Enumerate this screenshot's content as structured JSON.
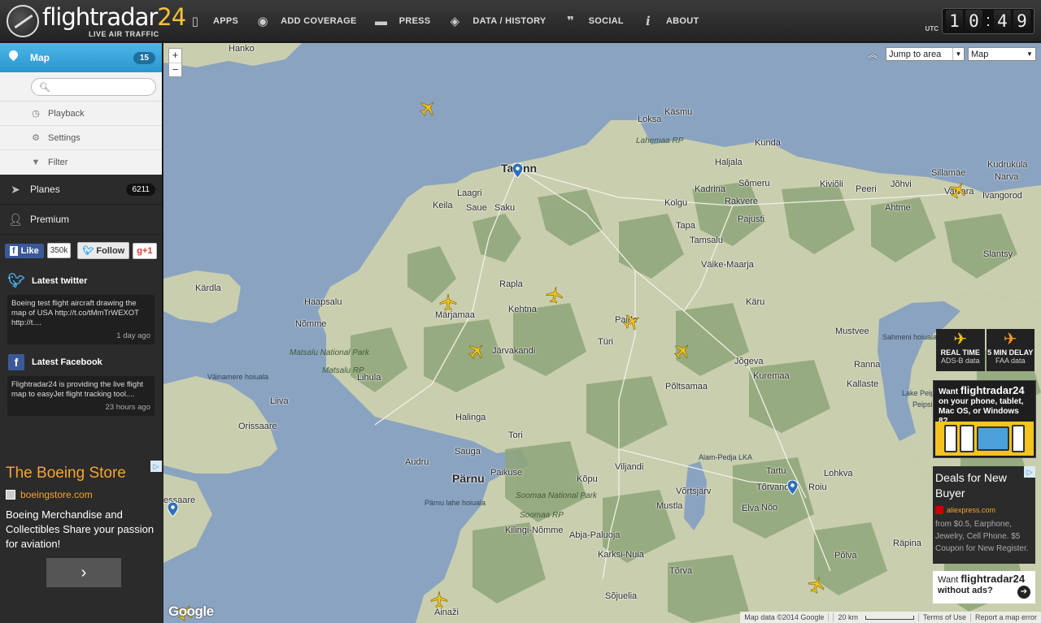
{
  "brand": {
    "name_main": "flightradar",
    "name_num": "24",
    "tagline": "LIVE AIR TRAFFIC"
  },
  "nav": [
    {
      "label": "APPS",
      "icon": "phone-icon"
    },
    {
      "label": "ADD COVERAGE",
      "icon": "eye-icon"
    },
    {
      "label": "PRESS",
      "icon": "speech-bubble-icon"
    },
    {
      "label": "DATA / HISTORY",
      "icon": "database-icon"
    },
    {
      "label": "SOCIAL",
      "icon": "quote-icon"
    },
    {
      "label": "ABOUT",
      "icon": "info-icon"
    }
  ],
  "clock": {
    "zone": "UTC",
    "h1": "1",
    "h2": "0",
    "sep": ":",
    "m1": "4",
    "m2": "9"
  },
  "sidebar": {
    "map_label": "Map",
    "map_count": "15",
    "search_placeholder": "",
    "playback": "Playback",
    "settings": "Settings",
    "filter": "Filter",
    "planes_label": "Planes",
    "planes_count": "6211",
    "premium": "Premium",
    "fb_like": "Like",
    "fb_count": "350k",
    "tw_follow": "Follow",
    "gplus": "g+1",
    "twitter_title": "Latest twitter",
    "twitter_text": "Boeing test flight aircraft drawing the map of USA http://t.co/tMmTrWEXOT http://t....",
    "twitter_time": "1 day ago",
    "facebook_title": "Latest Facebook",
    "facebook_text": "Flightradar24 is providing the live flight map to easyJet flight tracking tool....",
    "facebook_time": "23 hours ago"
  },
  "ad_left": {
    "title": "The Boeing Store",
    "url": "boeingstore.com",
    "body": "Boeing Merchandise and Collectibles Share your passion for aviation!",
    "button": "›"
  },
  "map": {
    "zoom_in": "+",
    "zoom_out": "−",
    "jump_to": "Jump to area",
    "map_type": "Map",
    "places": [
      "Hanko",
      "Käsmu",
      "Loksa",
      "Lahemaa RP",
      "Kunda",
      "Tallinn",
      "Haljala",
      "Sillamäe",
      "Kudruküla",
      "Narva",
      "Laagri",
      "Kadrina",
      "Sõmeru",
      "Kiviõli",
      "Peeri",
      "Jõhvi",
      "Keila",
      "Saue",
      "Saku",
      "Kolgu",
      "Rakvere",
      "Ahtme",
      "Vaivara",
      "Ivangorod",
      "Tapa",
      "Pajusti",
      "Tamsalu",
      "Slantsy",
      "Väike-Maarja",
      "Kärdla",
      "Haapsalu",
      "Rapla",
      "Kehtna",
      "Märjamaa",
      "Käru",
      "Nõmme",
      "Paide",
      "Türi",
      "Mustvee",
      "Sahmeni hoiualа",
      "Matsalu National Park",
      "Matsalu RP",
      "Järvakandi",
      "Jõgeva",
      "Ranna",
      "Väinamere hoiuala",
      "Lihula",
      "Kuremaa",
      "Põltsamaa",
      "Kallaste",
      "Lake Peipus",
      "Peipsi järv",
      "Liiva",
      "Orissaare",
      "Halinga",
      "Tori",
      "Audru",
      "Sauga",
      "Pärnu",
      "Paikuse",
      "Viljandi",
      "Alam-Pedja LKA",
      "Tartu",
      "Lohkva",
      "Pärnu lahe hoiuala",
      "Kõpu",
      "Võrtsjärv",
      "Tõrvandi",
      "Roiu",
      "Soomaa National Park",
      "Soomaa RP",
      "Mustla",
      "Elva",
      "Nõo",
      "Kilingi-Nõmme",
      "Abja-Paluoja",
      "Karksi-Nuia",
      "Põlva",
      "Räpina",
      "Tõrva",
      "Sõjuelia",
      "Ainaži",
      "essaare"
    ]
  },
  "right_panel": {
    "realtime_title": "REAL TIME",
    "realtime_sub": "ADS-B data",
    "delay_title": "5 MIN DELAY",
    "delay_sub": "FAA data",
    "want_prefix": "Want",
    "want_brand": "flightradar24",
    "want_devices": "on your phone, tablet, Mac OS, or Windows 8?",
    "ad_title": "Deals for New Buyer",
    "ad_url": "aliexpress.com",
    "ad_body": "from $0.5, Earphone, Jewelry, Cell Phone. $5 Coupon for New Register.",
    "noads_prefix": "Want",
    "noads_brand": "flightradar24",
    "noads_suffix": "without ads?"
  },
  "footer": {
    "google": "Google",
    "map_data": "Map data ©2014 Google",
    "scale": "20 km",
    "terms": "Terms of Use",
    "report": "Report a map error"
  },
  "colors": {
    "accent": "#2a96cf",
    "plane": "#f3c41f",
    "water": "#8aa3c0",
    "land": "#c9ceaf"
  }
}
